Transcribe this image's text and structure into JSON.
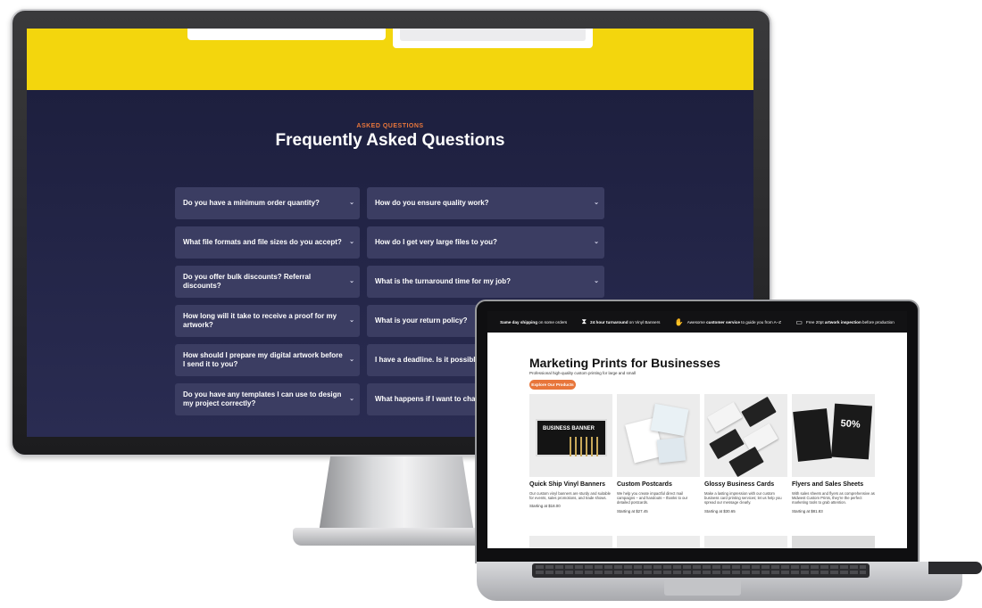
{
  "faq": {
    "kicker": "ASKED QUESTIONS",
    "title": "Frequently Asked Questions",
    "items": [
      {
        "q": "Do you have a minimum order quantity?"
      },
      {
        "q": "How do you ensure quality work?"
      },
      {
        "q": "What file formats and file sizes do you accept?"
      },
      {
        "q": "How do I get very large files to you?"
      },
      {
        "q": "Do you offer bulk discounts? Referral discounts?"
      },
      {
        "q": "What is the turnaround time for my job?"
      },
      {
        "q": "How long will it take to receive a proof for my artwork?"
      },
      {
        "q": "What is your return policy?"
      },
      {
        "q": "How should I prepare my digital artwork before I send it to you?"
      },
      {
        "q": "I have a deadline. Is it possible to"
      },
      {
        "q": "Do you have any templates I can use to design my project correctly?"
      },
      {
        "q": "What happens if I want to change order or approve my proof?"
      }
    ],
    "chevron": "⌄"
  },
  "promo_bar": {
    "items": [
      {
        "bold": "Same day shipping",
        "rest": " on some orders",
        "icon": "truck-icon"
      },
      {
        "bold": "24 hour turnaround",
        "rest": " on Vinyl Banners",
        "icon": "hourglass-icon"
      },
      {
        "bold": "customer service",
        "pre": "Awesome ",
        "rest": " to guide you from A–Z",
        "icon": "handshake-icon"
      },
      {
        "bold": "artwork inspection",
        "pre": "Free 20pt ",
        "rest": " before production",
        "icon": "monitor-icon"
      }
    ]
  },
  "marketing": {
    "heading": "Marketing Prints for Businesses",
    "subheading": "Professional high-quality custom printing for large and small",
    "cta": "Explore Our Products"
  },
  "products": [
    {
      "name": "Quick Ship Vinyl Banners",
      "desc": "Our custom vinyl banners are sturdy and suitable for events, sales promotions, and trade shows.",
      "price": "Starting at $18.00",
      "art_text": "BUSINESS BANNER"
    },
    {
      "name": "Custom Postcards",
      "desc": "We help you create impactful direct mail campaigns – and handouts – thanks to our detailed postcards.",
      "price": "Starting at $27.45"
    },
    {
      "name": "Glossy Business Cards",
      "desc": "Make a lasting impression with our custom business card printing services; let us help you spread our message clearly.",
      "price": "Starting at $30.65"
    },
    {
      "name": "Flyers and Sales Sheets",
      "desc": "With sales sheets and flyers as comprehensive as Midwest Custom Prints, they're the perfect marketing tools to grab attention.",
      "price": "Starting at $81.83",
      "art_text": "50%"
    }
  ],
  "colors": {
    "faq_bg": "#1d1f3e",
    "faq_item": "#3b3d62",
    "accent_orange": "#e8763b",
    "yellow": "#f3d60d"
  }
}
